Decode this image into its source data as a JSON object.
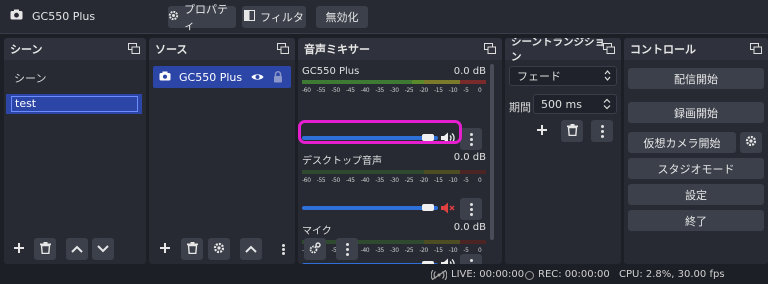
{
  "toolbar": {
    "source_name": "GC550 Plus",
    "properties_label": "プロパティ",
    "filters_label": "フィルタ",
    "disable_label": "無効化"
  },
  "docks": {
    "scenes": {
      "title": "シーン",
      "items": [
        {
          "label": "シーン"
        },
        {
          "label": "test"
        }
      ]
    },
    "sources": {
      "title": "ソース",
      "items": [
        {
          "label": "GC550 Plus"
        }
      ]
    },
    "mixer": {
      "title": "音声ミキサー",
      "tick_labels": [
        "-60",
        "-55",
        "-50",
        "-45",
        "-40",
        "-35",
        "-30",
        "-25",
        "-20",
        "-15",
        "-10",
        "-5",
        "0"
      ],
      "channels": [
        {
          "name": "GC550 Plus",
          "level": "0.0 dB",
          "volume": 0.95,
          "muted": false,
          "meter_green": 0.62
        },
        {
          "name": "デスクトップ音声",
          "level": "0.0 dB",
          "volume": 0.95,
          "muted": true,
          "meter_green": 0.0
        },
        {
          "name": "マイク",
          "level": "0.0 dB",
          "volume": 0.95,
          "muted": false,
          "meter_green": 0.0
        }
      ]
    },
    "transitions": {
      "title": "シーントランジション",
      "transition_value": "フェード",
      "duration_label": "期間",
      "duration_value": "500 ms"
    },
    "controls": {
      "title": "コントロール",
      "buttons": [
        {
          "label": "配信開始"
        },
        {
          "label": "録画開始"
        },
        {
          "label": "仮想カメラ開始"
        },
        {
          "label": "スタジオモード"
        },
        {
          "label": "設定"
        },
        {
          "label": "終了"
        }
      ]
    }
  },
  "status": {
    "live": "LIVE: 00:00:00",
    "rec": "REC: 00:00:00",
    "cpu": "CPU: 2.8%, 30.00 fps"
  },
  "colors": {
    "accent_selection": "#2c46a8",
    "volume_bar": "#2f6fd8",
    "highlight_ring": "#e51fd0",
    "muted_icon": "#e04040"
  }
}
